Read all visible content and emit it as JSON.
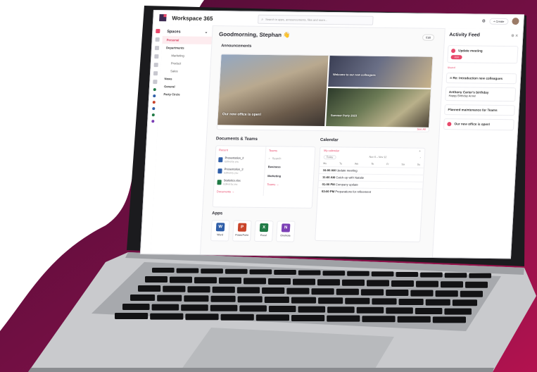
{
  "colors": {
    "accent": "#e8486b",
    "bg_dark": "#5a0f3a",
    "bg_magenta": "#a8124f"
  },
  "topbar": {
    "title": "Workspace 365",
    "search_placeholder": "Search in apps, announcements, files and more...",
    "create_label": "+ Create"
  },
  "sidebar": {
    "heading": "Spaces",
    "items": [
      {
        "label": "Personal"
      },
      {
        "label": "Departments"
      },
      {
        "label": "Marketing"
      },
      {
        "label": "Product"
      },
      {
        "label": "Sales"
      },
      {
        "label": "News"
      },
      {
        "label": "General"
      },
      {
        "label": "Party Circle"
      }
    ]
  },
  "main": {
    "greeting": "Goodmorning, Stephan 👋",
    "edit_label": "Edit",
    "announcements_title": "Announcements",
    "announcement_1": "Our new office is open!",
    "announcement_2": "Welcome to our new colleagues",
    "announcement_3": "Summer Party 2023",
    "see_all": "See All",
    "docs_title": "Documents & Teams",
    "docs_tab": "Recent",
    "teams_tab": "Teams",
    "docs": [
      {
        "name": "Presentation_2",
        "meta": "Edited by you"
      },
      {
        "name": "Presentation_3",
        "meta": "Edited by you"
      },
      {
        "name": "Statistics.xlsx",
        "meta": "Edited by you"
      }
    ],
    "teams_search": "Search",
    "teams": [
      "Business",
      "Marketing"
    ],
    "documents_link": "Documents →",
    "teams_link": "Teams →",
    "calendar_title": "Calendar",
    "calendar_sel": "My calendar",
    "calendar_today": "Today",
    "calendar_range": "Nov 6 – Nov 12",
    "weekdays": [
      "Mo",
      "Tu",
      "We",
      "Th",
      "Fr",
      "Sa",
      "Su"
    ],
    "events": [
      {
        "time": "10:00 AM",
        "title": "Update meeting"
      },
      {
        "time": "11:00 AM",
        "title": "Catch-up with Natalie"
      },
      {
        "time": "01:00 PM",
        "title": "Company update"
      },
      {
        "time": "03:00 PM",
        "title": "Preparations for refinement"
      }
    ],
    "apps_title": "Apps",
    "apps": [
      {
        "name": "Word",
        "letter": "W",
        "color": "#2f5ea8"
      },
      {
        "name": "PowerPoint",
        "letter": "P",
        "color": "#c9442a"
      },
      {
        "name": "Excel",
        "letter": "X",
        "color": "#1f7a45"
      },
      {
        "name": "OneNote",
        "letter": "N",
        "color": "#7b3fb5"
      }
    ]
  },
  "feed": {
    "title": "Activity Feed",
    "card1_title": "Update meeting",
    "card1_btn": "Join",
    "section_label": "Shared",
    "card2_title": "Re: Introduction new colleagues",
    "card3_title": "Anthony Carter's birthday",
    "card3_text": "Happy Birthday Anne!",
    "card4_title": "Planned maintenance for Teams",
    "card5_title": "Our new office is open!"
  }
}
